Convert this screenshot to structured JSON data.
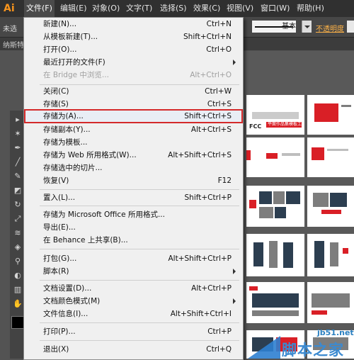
{
  "app": {
    "logo": "Ai"
  },
  "menubar": {
    "items": [
      {
        "label": "文件(F)"
      },
      {
        "label": "编辑(E)"
      },
      {
        "label": "对象(O)"
      },
      {
        "label": "文字(T)"
      },
      {
        "label": "选择(S)"
      },
      {
        "label": "效果(C)"
      },
      {
        "label": "视图(V)"
      },
      {
        "label": "窗口(W)"
      },
      {
        "label": "帮助(H)"
      }
    ]
  },
  "controlbar": {
    "selection_status": "未选",
    "stroke_style": "基本",
    "opacity_label": "不透明度"
  },
  "doc_tab": {
    "label": "纳斯特"
  },
  "file_menu": {
    "items": [
      {
        "label": "新建(N)...",
        "shortcut": "Ctrl+N"
      },
      {
        "label": "从模板新建(T)...",
        "shortcut": "Shift+Ctrl+N"
      },
      {
        "label": "打开(O)...",
        "shortcut": "Ctrl+O"
      },
      {
        "label": "最近打开的文件(F)",
        "shortcut": ""
      },
      {
        "label": "在 Bridge 中浏览...",
        "shortcut": "Alt+Ctrl+O"
      },
      {
        "label": "关闭(C)",
        "shortcut": "Ctrl+W"
      },
      {
        "label": "存储(S)",
        "shortcut": "Ctrl+S"
      },
      {
        "label": "存储为(A)...",
        "shortcut": "Shift+Ctrl+S"
      },
      {
        "label": "存储副本(Y)...",
        "shortcut": "Alt+Ctrl+S"
      },
      {
        "label": "存储为模板...",
        "shortcut": ""
      },
      {
        "label": "存储为 Web 所用格式(W)...",
        "shortcut": "Alt+Shift+Ctrl+S"
      },
      {
        "label": "存储选中的切片...",
        "shortcut": ""
      },
      {
        "label": "恢复(V)",
        "shortcut": "F12"
      },
      {
        "label": "置入(L)...",
        "shortcut": "Shift+Ctrl+P"
      },
      {
        "label": "存储为 Microsoft Office 所用格式...",
        "shortcut": ""
      },
      {
        "label": "导出(E)...",
        "shortcut": ""
      },
      {
        "label": "在 Behance 上共享(B)...",
        "shortcut": ""
      },
      {
        "label": "打包(G)...",
        "shortcut": "Alt+Shift+Ctrl+P"
      },
      {
        "label": "脚本(R)",
        "shortcut": ""
      },
      {
        "label": "文档设置(D)...",
        "shortcut": "Alt+Ctrl+P"
      },
      {
        "label": "文档颜色模式(M)",
        "shortcut": ""
      },
      {
        "label": "文件信息(I)...",
        "shortcut": "Alt+Shift+Ctrl+I"
      },
      {
        "label": "打印(P)...",
        "shortcut": "Ctrl+P"
      },
      {
        "label": "退出(X)",
        "shortcut": "Ctrl+Q"
      }
    ]
  },
  "artboards": {
    "banner_text": "平面作品集模板工程",
    "logo_text": "FCC"
  },
  "watermark": {
    "url": "jb51.net",
    "brand": "脚本之家"
  },
  "colors": {
    "highlight_border": "#d42a2a",
    "accent_red": "#d91f26",
    "menubar_bg": "#303030"
  }
}
